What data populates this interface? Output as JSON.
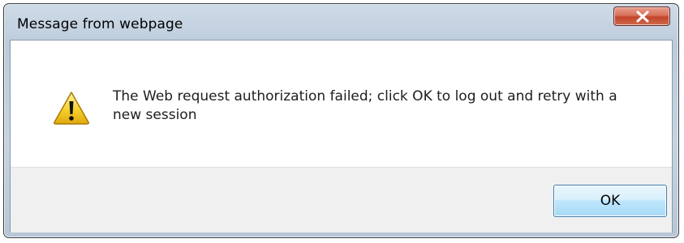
{
  "dialog": {
    "title": "Message from webpage",
    "message": "The Web request authorization failed; click OK to log out and retry with a new session",
    "ok_label": "OK"
  },
  "icons": {
    "close": "close-icon",
    "warning": "warning-icon"
  },
  "colors": {
    "close_button": "#c9533a",
    "ok_button_border": "#3c7fb1",
    "warning_fill": "#f5d12b"
  }
}
